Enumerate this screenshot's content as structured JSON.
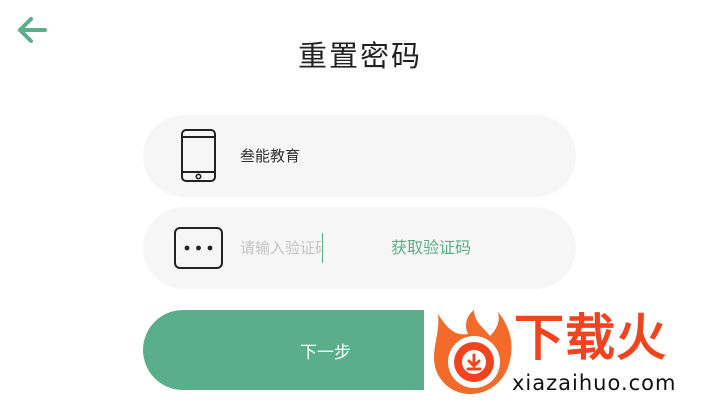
{
  "header": {
    "title": "重置密码",
    "back_icon": "arrow-left-icon"
  },
  "form": {
    "account": {
      "icon": "phone-icon",
      "value": "叁能教育"
    },
    "code": {
      "icon": "password-dots-icon",
      "placeholder": "请输入验证码",
      "get_code_label": "获取验证码"
    },
    "next_label": "下一步"
  },
  "watermark": {
    "brand": "下载火",
    "domain": "xiazaihuo.com"
  },
  "colors": {
    "accent": "#5aae8c",
    "input_bg": "#f6f6f6",
    "watermark_red": "#f04420"
  }
}
